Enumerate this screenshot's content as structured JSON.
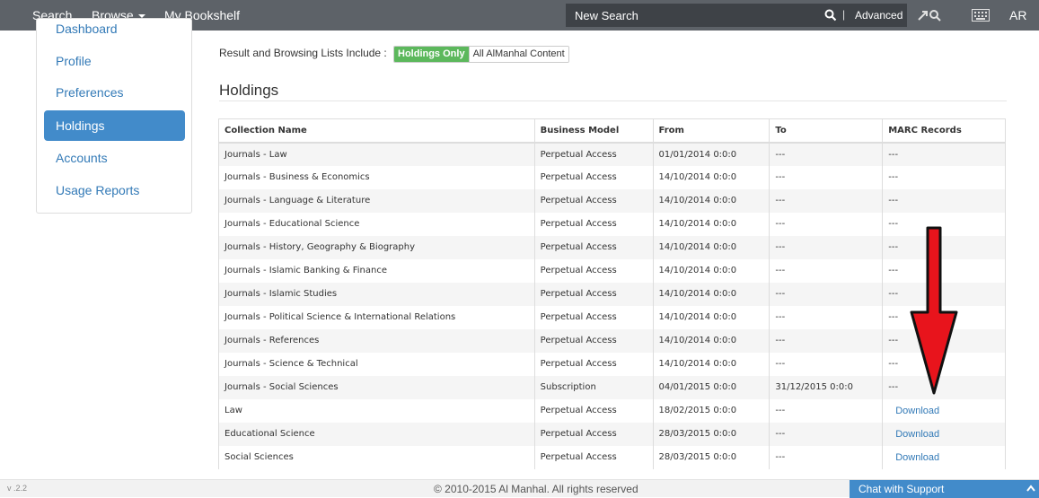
{
  "nav": {
    "search": "Search",
    "browse": "Browse",
    "bookshelf": "My Bookshelf",
    "search_placeholder": "New Search",
    "separator": "|",
    "advanced": "Advanced",
    "language": "AR"
  },
  "sidebar": {
    "items": [
      {
        "label": "Dashboard"
      },
      {
        "label": "Profile"
      },
      {
        "label": "Preferences"
      },
      {
        "label": "Holdings",
        "active": true
      },
      {
        "label": "Accounts"
      },
      {
        "label": "Usage Reports"
      }
    ]
  },
  "main": {
    "filter_label": "Result and Browsing Lists Include :",
    "filter_options": [
      "Holdings Only",
      "All AlManhal Content"
    ],
    "heading": "Holdings",
    "table": {
      "headers": [
        "Collection Name",
        "Business Model",
        "From",
        "To",
        "MARC Records"
      ],
      "rows": [
        [
          "Journals - Law",
          "Perpetual Access",
          "01/01/2014 0:0:0",
          "---",
          "---"
        ],
        [
          "Journals - Business & Economics",
          "Perpetual Access",
          "14/10/2014 0:0:0",
          "---",
          "---"
        ],
        [
          "Journals - Language & Literature",
          "Perpetual Access",
          "14/10/2014 0:0:0",
          "---",
          "---"
        ],
        [
          "Journals - Educational Science",
          "Perpetual Access",
          "14/10/2014 0:0:0",
          "---",
          "---"
        ],
        [
          "Journals - History, Geography & Biography",
          "Perpetual Access",
          "14/10/2014 0:0:0",
          "---",
          "---"
        ],
        [
          "Journals - Islamic Banking & Finance",
          "Perpetual Access",
          "14/10/2014 0:0:0",
          "---",
          "---"
        ],
        [
          "Journals - Islamic Studies",
          "Perpetual Access",
          "14/10/2014 0:0:0",
          "---",
          "---"
        ],
        [
          "Journals - Political Science & International Relations",
          "Perpetual Access",
          "14/10/2014 0:0:0",
          "---",
          "---"
        ],
        [
          "Journals - References",
          "Perpetual Access",
          "14/10/2014 0:0:0",
          "---",
          "---"
        ],
        [
          "Journals - Science & Technical",
          "Perpetual Access",
          "14/10/2014 0:0:0",
          "---",
          "---"
        ],
        [
          "Journals - Social Sciences",
          "Subscription",
          "04/01/2015 0:0:0",
          "31/12/2015 0:0:0",
          "---"
        ],
        [
          "Law",
          "Perpetual Access",
          "18/02/2015 0:0:0",
          "---",
          "Download"
        ],
        [
          "Educational Science",
          "Perpetual Access",
          "28/03/2015 0:0:0",
          "---",
          "Download"
        ],
        [
          "Social Sciences",
          "Perpetual Access",
          "28/03/2015 0:0:0",
          "---",
          "Download"
        ]
      ]
    }
  },
  "footer": {
    "version": "v .2.2",
    "copyright": "© 2010-2015 Al Manhal. All rights reserved",
    "chat": "Chat with Support"
  },
  "colors": {
    "navbar": "#5d6268",
    "active_item": "#428bca",
    "link": "#337ab7",
    "holdings_only_button": "#5cb85c",
    "annotation_arrow": "#e8141c"
  }
}
